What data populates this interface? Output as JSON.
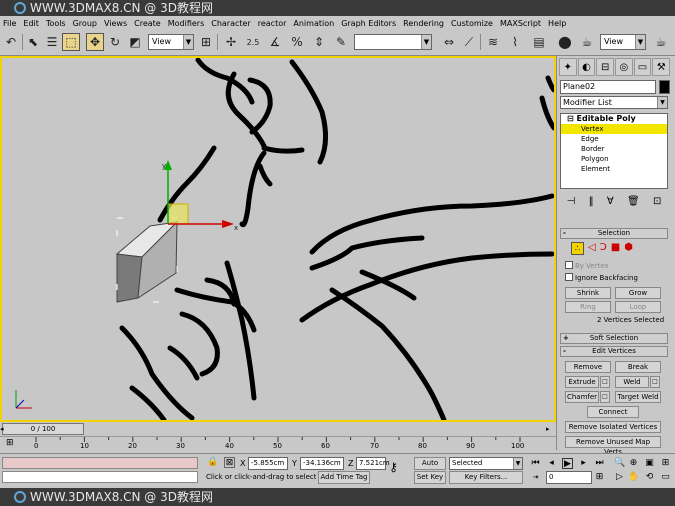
{
  "watermark": {
    "text": "WWW.3DMAX8.CN @ 3D教程网"
  },
  "menu": [
    "File",
    "Edit",
    "Tools",
    "Group",
    "Views",
    "Create",
    "Modifiers",
    "Character",
    "reactor",
    "Animation",
    "Graph Editors",
    "Rendering",
    "Customize",
    "MAXScript",
    "Help"
  ],
  "toolbar": {
    "ref_coord": "View",
    "selection_set": "",
    "view_right": "View",
    "snap_angle": "2.5"
  },
  "panel": {
    "object_name": "Plane02",
    "modifier_list": "Modifier List",
    "stack": {
      "root": "Editable Poly",
      "items": [
        "Vertex",
        "Edge",
        "Border",
        "Polygon",
        "Element"
      ],
      "selected": "Vertex"
    },
    "selection": {
      "title": "Selection",
      "by_vertex": "By Vertex",
      "ignore_backfacing": "Ignore Backfacing",
      "shrink": "Shrink",
      "grow": "Grow",
      "ring": "Ring",
      "loop": "Loop",
      "status": "2 Vertices Selected"
    },
    "soft_selection": {
      "title": "Soft Selection"
    },
    "edit_vertices": {
      "title": "Edit Vertices",
      "remove": "Remove",
      "break": "Break",
      "extrude": "Extrude",
      "weld": "Weld",
      "chamfer": "Chamfer",
      "target_weld": "Target Weld",
      "connect": "Connect",
      "remove_isolated": "Remove Isolated Vertices",
      "remove_unused": "Remove Unused Map Verts"
    }
  },
  "timeline": {
    "slider": "0 / 100",
    "ticks": [
      "0",
      "10",
      "20",
      "30",
      "40",
      "50",
      "60",
      "70",
      "80",
      "90",
      "100"
    ]
  },
  "status": {
    "x_label": "X",
    "x": "-5.855cm",
    "y_label": "Y",
    "y": "-34.136cm",
    "z_label": "Z",
    "z": "7.521cm",
    "prompt": "Click or click-and-drag to select ob",
    "add_time_tag": "Add Time Tag",
    "auto_key": "Auto Key",
    "set_key": "Set Key",
    "key_mode": "Selected",
    "key_filters": "Key Filters...",
    "frame": "0"
  },
  "colors": {
    "viewport_border": "#f2d200",
    "selected_stack": "#f2e600",
    "vertex_mode": "#f2d200"
  }
}
